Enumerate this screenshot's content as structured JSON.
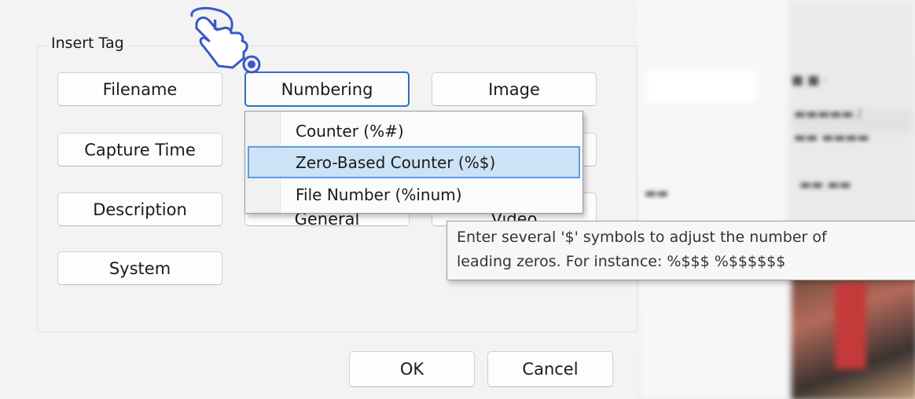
{
  "group": {
    "title": "Insert Tag"
  },
  "buttons": {
    "filename": "Filename",
    "numbering": "Numbering",
    "image": "Image",
    "capture_time": "Capture Time",
    "description": "Description",
    "general": "General",
    "video": "Video",
    "system": "System",
    "ok": "OK",
    "cancel": "Cancel"
  },
  "menu": {
    "items": [
      {
        "label": "Counter (%#)"
      },
      {
        "label": "Zero-Based Counter (%$)"
      },
      {
        "label": "File Number (%inum)"
      }
    ],
    "highlighted_index": 1
  },
  "tooltip": {
    "line1": "Enter several '$' symbols to adjust the number of",
    "line2": "leading zeros. For instance: %$$$ %$$$$$$"
  },
  "cursor": {
    "badge": "L"
  },
  "colors": {
    "accent": "#2f6fc4",
    "highlight_bg": "#cce3f7",
    "highlight_border": "#5d9ce1",
    "cursor_blue": "#3a58c8"
  }
}
